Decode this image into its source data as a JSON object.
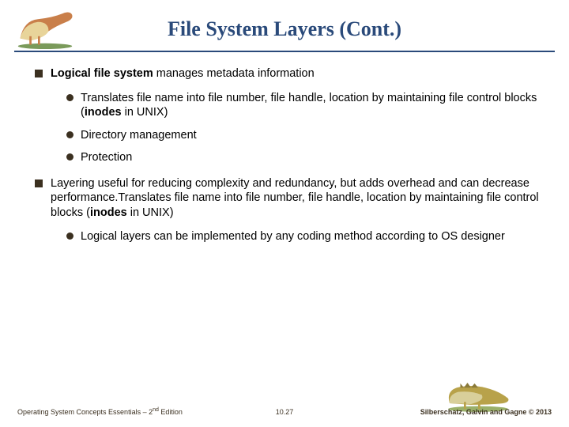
{
  "title": "File System Layers (Cont.)",
  "bullets": {
    "b1_bold": "Logical file system",
    "b1_rest": " manages metadata information",
    "b1a_pre": "Translates file name into file number, file handle, location by maintaining file control blocks (",
    "b1a_bold": "inodes",
    "b1a_post": " in UNIX)",
    "b1b": "Directory management",
    "b1c": "Protection",
    "b2_pre": "Layering useful for reducing complexity and redundancy, but adds overhead and can decrease performance.Translates file name into file number, file handle, location by maintaining file control blocks (",
    "b2_bold": "inodes",
    "b2_post": " in UNIX)",
    "b2a": "Logical layers can be implemented by any coding method according to OS designer"
  },
  "footer": {
    "left_pre": "Operating System Concepts Essentials – 2",
    "left_sup": "nd",
    "left_post": " Edition",
    "center": "10.27",
    "right": "Silberschatz, Galvin and Gagne © 2013"
  }
}
